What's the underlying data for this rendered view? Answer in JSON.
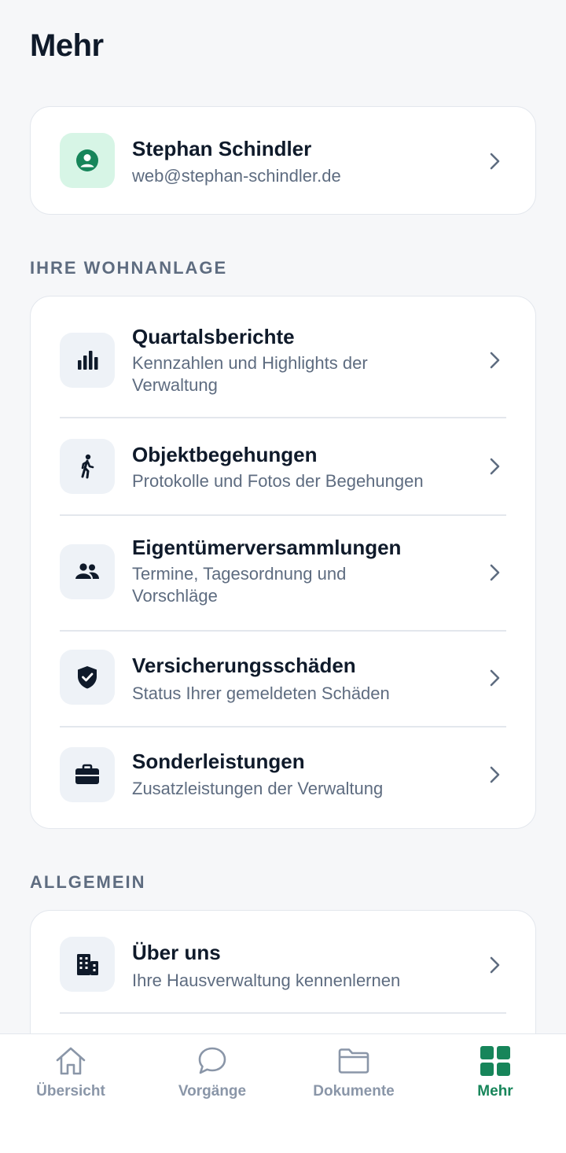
{
  "header": {
    "title": "Mehr"
  },
  "profile": {
    "name": "Stephan Schindler",
    "email": "web@stephan-schindler.de",
    "icon": "user-circle-icon"
  },
  "wohnanlage": {
    "title": "IHRE WOHNANLAGE",
    "items": [
      {
        "title": "Quartalsberichte",
        "subtitle": "Kennzahlen und Highlights der Verwaltung",
        "icon": "bar-chart-icon"
      },
      {
        "title": "Objektbegehungen",
        "subtitle": "Protokolle und Fotos der Begehungen",
        "icon": "walking-person-icon"
      },
      {
        "title": "Eigentümerversammlungen",
        "subtitle": "Termine, Tagesordnung und Vorschläge",
        "icon": "people-icon"
      },
      {
        "title": "Versicherungsschäden",
        "subtitle": "Status Ihrer gemeldeten Schäden",
        "icon": "shield-check-icon"
      },
      {
        "title": "Sonderleistungen",
        "subtitle": "Zusatzleistungen der Verwaltung",
        "icon": "briefcase-icon"
      }
    ]
  },
  "allgemein": {
    "title": "ALLGEMEIN",
    "items": [
      {
        "title": "Über uns",
        "subtitle": "Ihre Hausverwaltung kennenlernen",
        "icon": "building-icon"
      }
    ]
  },
  "tabs": [
    {
      "label": "Übersicht",
      "icon": "home-icon"
    },
    {
      "label": "Vorgänge",
      "icon": "chat-bubble-icon"
    },
    {
      "label": "Dokumente",
      "icon": "folder-icon"
    },
    {
      "label": "Mehr",
      "icon": "grid-icon",
      "active": true
    }
  ],
  "colors": {
    "accent": "#17855a",
    "text": "#0f1a2a",
    "muted": "#5e6c80",
    "background": "#f6f7f9"
  }
}
